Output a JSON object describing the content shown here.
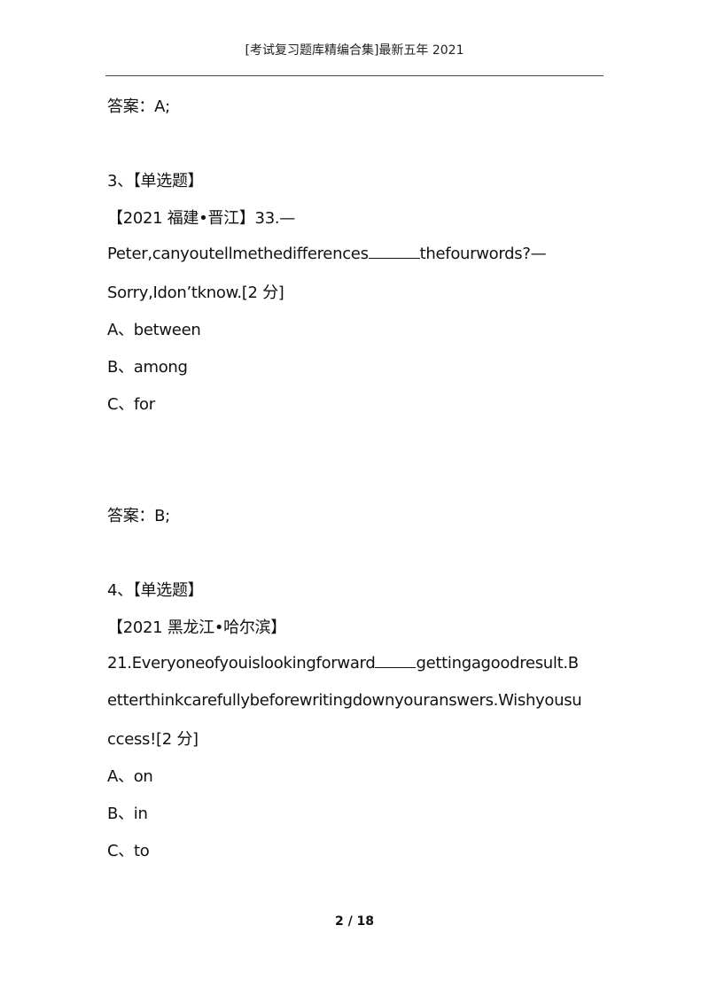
{
  "header": {
    "title": "[考试复习题库精编合集]最新五年 2021"
  },
  "answers": [
    {
      "label": "答案：A;"
    },
    {
      "label": "答案：B;"
    }
  ],
  "questions": [
    {
      "number_type": "3、【单选题】",
      "source": "【2021 福建•晋江】33.—",
      "stem_lines": [
        {
          "before": "Peter,canyoutellmethedifferences",
          "blank": "______",
          "after": "thefourwords?—"
        },
        {
          "before": "Sorry,Idon’tknow.[2 分]"
        }
      ],
      "options": [
        "A、between",
        "B、among",
        "C、for"
      ]
    },
    {
      "number_type": "4、【单选题】",
      "source": "【2021 黑龙江•哈尔滨】",
      "stem_lines": [
        {
          "before": "21.Everyoneofyouislookingforward",
          "blank": "_____",
          "after": "gettingagoodresult.B"
        },
        {
          "before": "etterthinkcarefullybeforewritingdownyouranswers.Wishyousu"
        },
        {
          "before": "ccess![2 分]"
        }
      ],
      "options": [
        "A、on",
        "B、in",
        "C、to"
      ]
    }
  ],
  "footer": {
    "page_indicator": "2 / 18"
  }
}
